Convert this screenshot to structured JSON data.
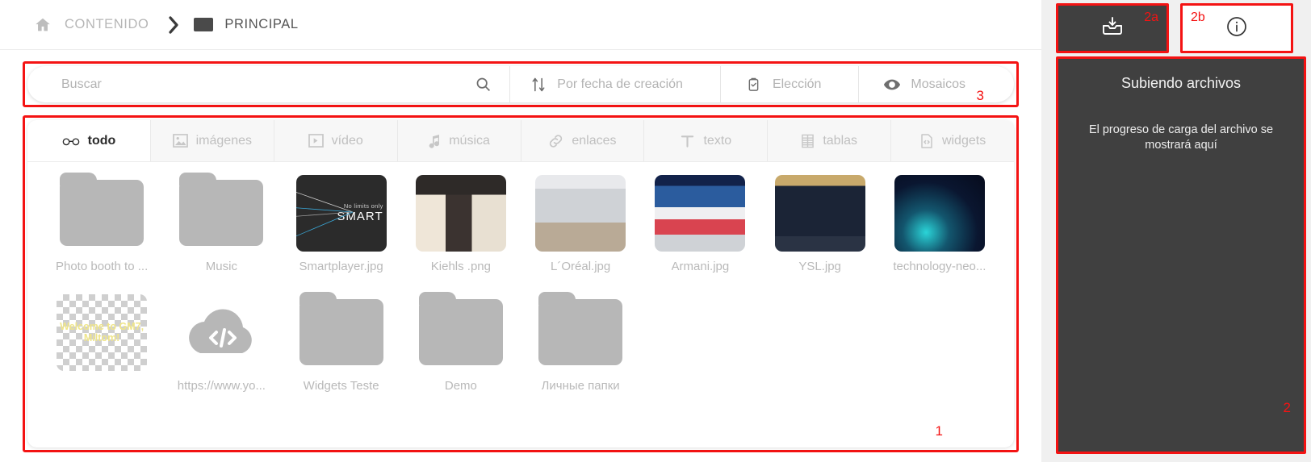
{
  "breadcrumb": {
    "home_icon": "home-icon",
    "root_label": "CONTENIDO",
    "separator": "›",
    "folder_icon": "folder-icon",
    "current_label": "PRINCIPAL"
  },
  "toolbar": {
    "search": {
      "value": "",
      "placeholder": "Buscar",
      "icon": "search-icon"
    },
    "sort": {
      "label": "Por fecha de creación",
      "icon": "sort-icon"
    },
    "selection": {
      "label": "Elección",
      "icon": "clipboard-check-icon"
    },
    "view": {
      "label": "Mosaicos",
      "icon": "eye-icon"
    }
  },
  "tabs": [
    {
      "label": "todo",
      "icon": "glasses-icon",
      "active": true
    },
    {
      "label": "imágenes",
      "icon": "image-icon",
      "active": false
    },
    {
      "label": "vídeo",
      "icon": "video-icon",
      "active": false
    },
    {
      "label": "música",
      "icon": "music-note-icon",
      "active": false
    },
    {
      "label": "enlaces",
      "icon": "link-icon",
      "active": false
    },
    {
      "label": "texto",
      "icon": "text-t-icon",
      "active": false
    },
    {
      "label": "tablas",
      "icon": "table-icon",
      "active": false
    },
    {
      "label": "widgets",
      "icon": "widget-code-icon",
      "active": false
    }
  ],
  "files": [
    {
      "name": "Photo booth to ...",
      "kind": "folder"
    },
    {
      "name": "Music",
      "kind": "folder"
    },
    {
      "name": "Smartplayer.jpg",
      "kind": "image",
      "thumb_class": "ph-smart",
      "overlay_small": "No limits only",
      "overlay_big": "SMART"
    },
    {
      "name": "Kiehls .png",
      "kind": "image",
      "thumb_class": "ph-kiehls"
    },
    {
      "name": "L´Oréal.jpg",
      "kind": "image",
      "thumb_class": "ph-loreal"
    },
    {
      "name": "Armani.jpg",
      "kind": "image",
      "thumb_class": "ph-armani"
    },
    {
      "name": "YSL.jpg",
      "kind": "image",
      "thumb_class": "ph-ysl"
    },
    {
      "name": "technology-neo...",
      "kind": "image",
      "thumb_class": "ph-tech"
    },
    {
      "name": "",
      "kind": "transparent-image",
      "thumb_class": "ph-checker",
      "overlay_text": "Welcome to GM7, Miltom!"
    },
    {
      "name": "https://www.yo...",
      "kind": "link"
    },
    {
      "name": "Widgets Teste",
      "kind": "folder"
    },
    {
      "name": "Demo",
      "kind": "folder"
    },
    {
      "name": "Личные папки",
      "kind": "folder"
    }
  ],
  "right_panel": {
    "upload_button": {
      "icon": "upload-tray-icon",
      "annotation": "2a"
    },
    "info_button": {
      "icon": "info-circle-icon",
      "annotation": "2b"
    },
    "title": "Subiendo archivos",
    "subtitle": "El progreso de carga del archivo se mostrará aquí",
    "annotation": "2"
  },
  "annotations": {
    "grid": "1",
    "toolbar": "3",
    "highlight_color": "#f41313"
  }
}
